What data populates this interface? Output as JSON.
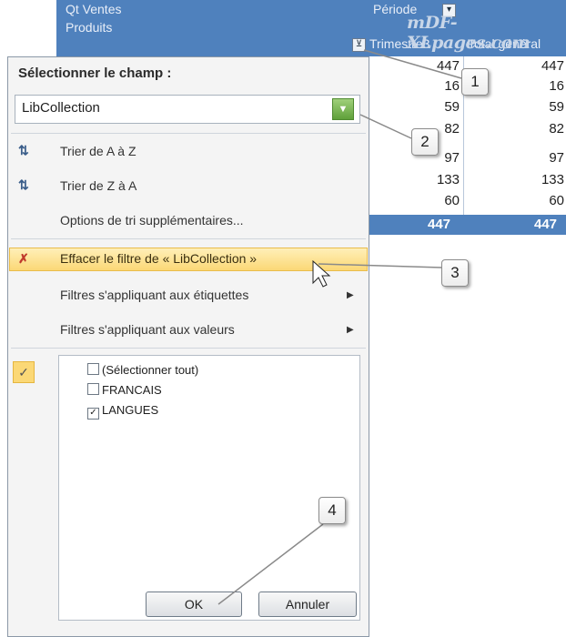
{
  "pivot": {
    "row1": "Qt Ventes",
    "row2": "Produits",
    "col_field": "Période",
    "col_header": "Trimestre3",
    "total_header": "Total général",
    "values": [
      "447",
      "16",
      "59",
      "82",
      "97",
      "133",
      "60"
    ],
    "totals_col": [
      "447",
      "16",
      "59",
      "82",
      "97",
      "133",
      "60"
    ],
    "grand_total": "447",
    "grand_total2": "447",
    "watermark": "mDF-XLpages.com"
  },
  "filter_menu": {
    "title": "Sélectionner le champ :",
    "field_value": "LibCollection",
    "items": [
      {
        "label": "Trier de A à Z",
        "icon": "sort-az-icon"
      },
      {
        "label": "Trier de Z à A",
        "icon": "sort-za-icon"
      },
      {
        "label": "Options de tri supplémentaires..."
      },
      {
        "label": "Effacer le filtre de « LibCollection »",
        "icon": "clear-filter-icon"
      },
      {
        "label": "Filtres s'appliquant aux étiquettes"
      },
      {
        "label": "Filtres s'appliquant aux valeurs"
      }
    ],
    "checklist": [
      {
        "label": "(Sélectionner tout)",
        "checked": false
      },
      {
        "label": "FRANCAIS",
        "checked": false
      },
      {
        "label": "LANGUES",
        "checked": true
      }
    ],
    "ok_label": "OK",
    "cancel_label": "Annuler"
  },
  "callouts": [
    "1",
    "2",
    "3",
    "4"
  ],
  "colors": {
    "header_blue": "#4f81bd",
    "highlight": "#fbd876",
    "combo_button": "#5fa03a"
  }
}
